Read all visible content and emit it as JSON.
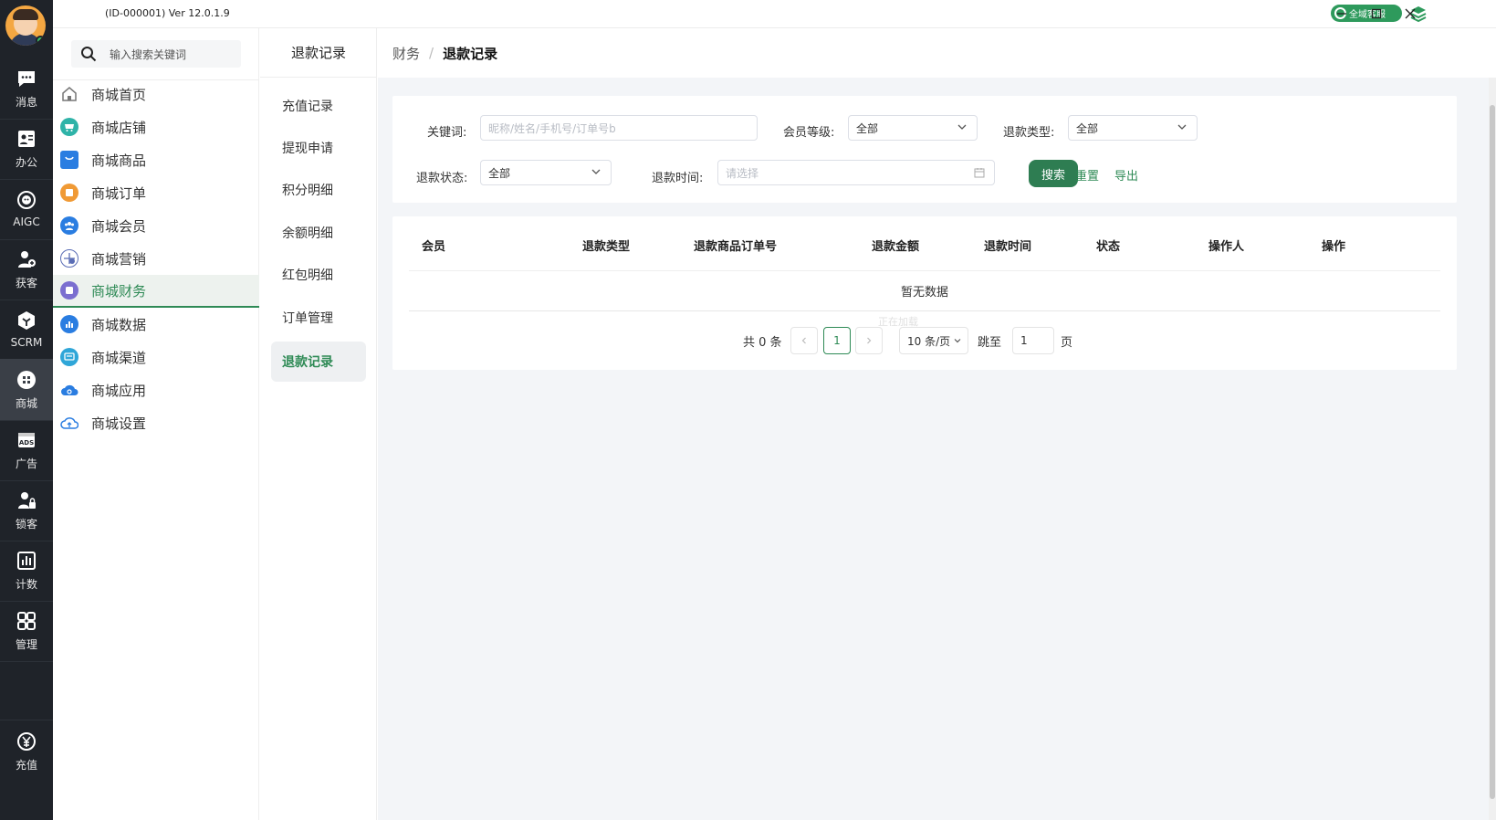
{
  "app": {
    "version_text": "(ID-000001)  Ver 12.0.1.9",
    "service_label": "全域客服"
  },
  "rail": {
    "items": [
      {
        "label": "消息",
        "icon": "message-icon"
      },
      {
        "label": "办公",
        "icon": "office-icon"
      },
      {
        "label": "AIGC",
        "icon": "aigc-icon"
      },
      {
        "label": "获客",
        "icon": "acquire-icon"
      },
      {
        "label": "SCRM",
        "icon": "scrm-icon"
      },
      {
        "label": "商城",
        "icon": "mall-icon"
      },
      {
        "label": "广告",
        "icon": "ads-icon"
      },
      {
        "label": "锁客",
        "icon": "lock-customer-icon"
      },
      {
        "label": "计数",
        "icon": "count-icon"
      },
      {
        "label": "管理",
        "icon": "manage-icon"
      }
    ],
    "recharge_label": "充值"
  },
  "sidebar": {
    "search_placeholder": "输入搜索关键词",
    "items": [
      {
        "label": "商城首页",
        "color": "#8a8a8a"
      },
      {
        "label": "商城店铺",
        "color": "#2fb3a8"
      },
      {
        "label": "商城商品",
        "color": "#2a7de1"
      },
      {
        "label": "商城订单",
        "color": "#f09a35"
      },
      {
        "label": "商城会员",
        "color": "#2a7de1"
      },
      {
        "label": "商城营销",
        "color": "#5a6db5"
      },
      {
        "label": "商城财务",
        "color": "#7b6fd0"
      },
      {
        "label": "商城数据",
        "color": "#2a7de1"
      },
      {
        "label": "商城渠道",
        "color": "#2fa6d8"
      },
      {
        "label": "商城应用",
        "color": "#2a7de1"
      },
      {
        "label": "商城设置",
        "color": "#2a7de1"
      }
    ]
  },
  "subnav": {
    "title": "退款记录",
    "items": [
      "充值记录",
      "提现申请",
      "积分明细",
      "余额明细",
      "红包明细",
      "订单管理",
      "退款记录"
    ]
  },
  "breadcrumb": {
    "parent": "财务",
    "separator": "/",
    "current": "退款记录"
  },
  "filters": {
    "keyword_label": "关键词:",
    "keyword_placeholder": "昵称/姓名/手机号/订单号b",
    "member_level_label": "会员等级:",
    "member_level_value": "全部",
    "refund_type_label": "退款类型:",
    "refund_type_value": "全部",
    "refund_status_label": "退款状态:",
    "refund_status_value": "全部",
    "refund_time_label": "退款时间:",
    "refund_time_placeholder": "请选择",
    "search_button": "搜索",
    "reset_link": "重置",
    "export_link": "导出"
  },
  "table": {
    "columns": [
      "会员",
      "退款类型",
      "退款商品订单号",
      "退款金额",
      "退款时间",
      "状态",
      "操作人",
      "操作"
    ],
    "empty_text": "暂无数据",
    "loading_text": "正在加载"
  },
  "pagination": {
    "total_text": "共 0 条",
    "current_page": "1",
    "page_size": "10 条/页",
    "jump_label": "跳至",
    "jump_value": "1",
    "page_suffix": "页"
  },
  "colors": {
    "accent": "#2e8a55",
    "button": "#2e7d52",
    "rail": "#1f2329"
  }
}
